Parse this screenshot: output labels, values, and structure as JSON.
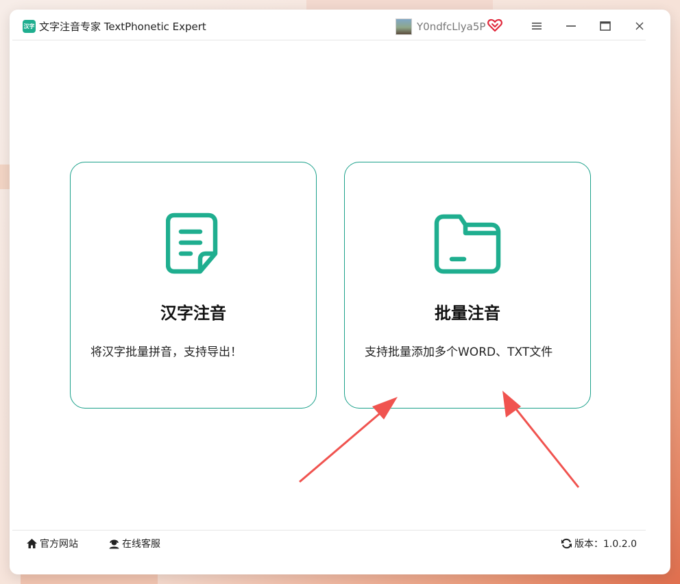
{
  "app": {
    "title": "文字注音专家 TextPhonetic Expert",
    "icon_label": "汉字"
  },
  "user": {
    "name": "Y0ndfcLlya5P"
  },
  "cards": [
    {
      "title": "汉字注音",
      "description": "将汉字批量拼音，支持导出！",
      "icon": "document-icon"
    },
    {
      "title": "批量注音",
      "description": "支持批量添加多个WORD、TXT文件",
      "icon": "folder-icon"
    }
  ],
  "footer": {
    "website": "官方网站",
    "support": "在线客服",
    "version": "版本：1.0.2.0"
  },
  "colors": {
    "accent": "#1aa08a",
    "arrow": "#f0534f"
  }
}
